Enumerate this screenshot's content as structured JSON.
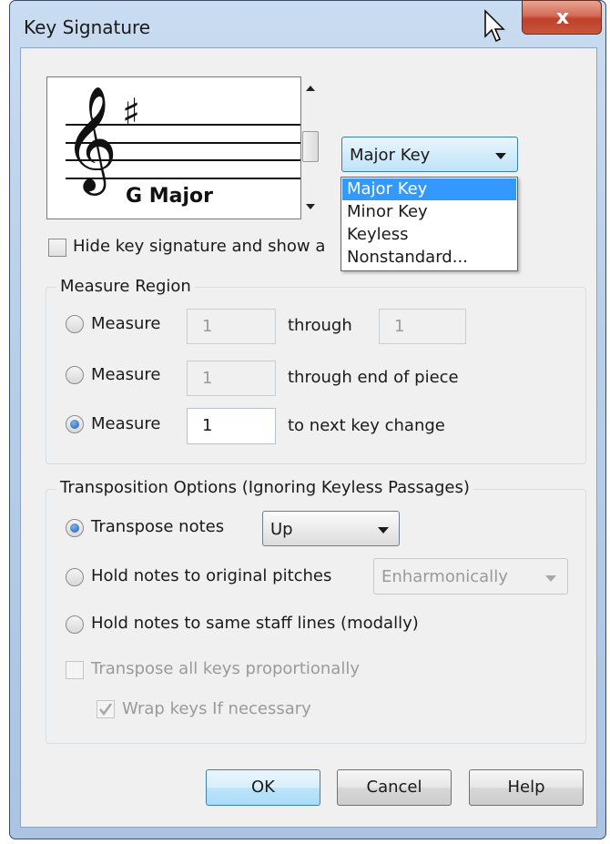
{
  "window": {
    "title": "Key Signature",
    "close_glyph": "x"
  },
  "preview": {
    "key_name": "G Major",
    "accidental": "♯",
    "clef": "𝄞"
  },
  "key_type_select": {
    "selected": "Major Key",
    "options": [
      "Major Key",
      "Minor Key",
      "Keyless",
      "Nonstandard..."
    ],
    "highlighted_index": 0
  },
  "hide_key_signature": {
    "label": "Hide key signature and show a",
    "checked": false
  },
  "measure_region": {
    "title": "Measure Region",
    "rows": [
      {
        "label": "Measure",
        "value": "1",
        "suffix": "through",
        "end_value": "1",
        "selected": false,
        "enabled": false
      },
      {
        "label": "Measure",
        "value": "1",
        "suffix": "through end of piece",
        "selected": false,
        "enabled": false
      },
      {
        "label": "Measure",
        "value": "1",
        "suffix": "to next key change",
        "selected": true,
        "enabled": true
      }
    ]
  },
  "transposition": {
    "title": "Transposition Options (Ignoring Keyless Passages)",
    "transpose_notes": {
      "label": "Transpose notes",
      "selected": true,
      "direction": "Up"
    },
    "hold_original": {
      "label": "Hold notes to original pitches",
      "selected": false,
      "method": "Enharmonically"
    },
    "hold_staff_lines": {
      "label": "Hold notes to same staff lines (modally)",
      "selected": false
    },
    "transpose_all_keys": {
      "label": "Transpose all keys proportionally",
      "checked": false,
      "enabled": false
    },
    "wrap_keys": {
      "label": "Wrap keys If necessary",
      "checked": true,
      "enabled": false
    }
  },
  "buttons": {
    "ok": "OK",
    "cancel": "Cancel",
    "help": "Help"
  },
  "colors": {
    "title_bar": "#b7cfe9",
    "dialog_bg": "#f0f0f0",
    "close_button": "#c8553d",
    "selection": "#3399ff"
  }
}
